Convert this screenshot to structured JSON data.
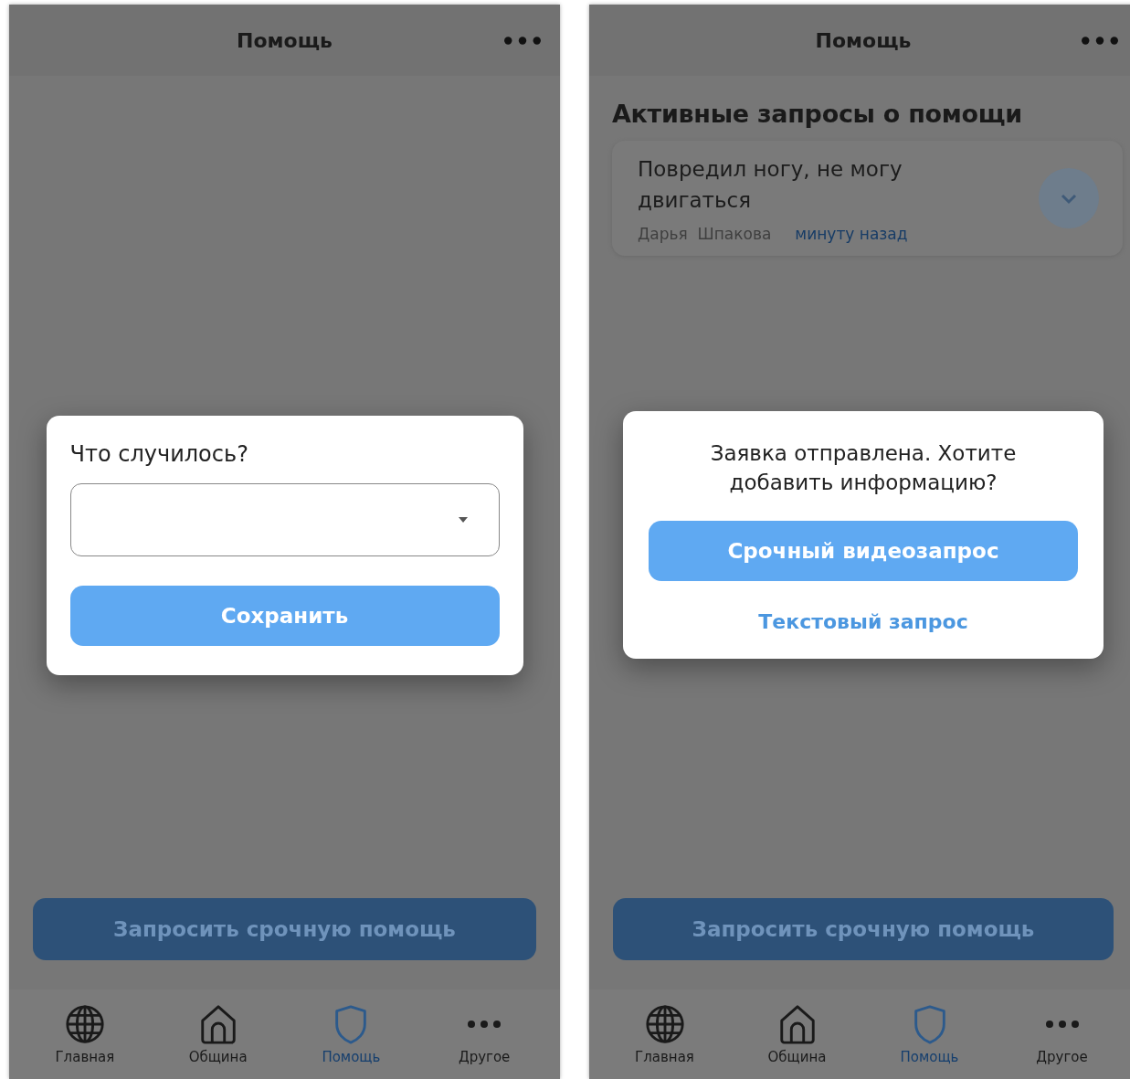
{
  "screens": [
    {
      "title": "Помощь",
      "dialog": {
        "kind": "form",
        "label": "Что случилось?",
        "button": "Сохранить"
      },
      "main_button": "Запросить срочную помощь",
      "nav": [
        {
          "kind": "globe",
          "label": "Главная",
          "selected": false
        },
        {
          "kind": "home",
          "label": "Община",
          "selected": false
        },
        {
          "kind": "shield",
          "label": "Помощь",
          "selected": true
        },
        {
          "kind": "more",
          "label": "Другое",
          "selected": false
        }
      ]
    },
    {
      "title": "Помощь",
      "section_title": "Активные запросы о помощи",
      "requests": [
        {
          "text": "Повредил ногу, не могу двигаться",
          "author": "Дарья  Шпакова",
          "time": "минуту назад"
        }
      ],
      "dialog": {
        "kind": "confirm",
        "message": "Заявка отправлена. Хотите добавить информацию?",
        "button": "Срочный видеозапрос",
        "link": "Текстовый запрос"
      },
      "main_button": "Запросить срочную помощь",
      "nav": [
        {
          "kind": "globe",
          "label": "Главная",
          "selected": false
        },
        {
          "kind": "home",
          "label": "Община",
          "selected": false
        },
        {
          "kind": "shield",
          "label": "Помощь",
          "selected": true
        },
        {
          "kind": "more",
          "label": "Другое",
          "selected": false
        }
      ]
    }
  ]
}
